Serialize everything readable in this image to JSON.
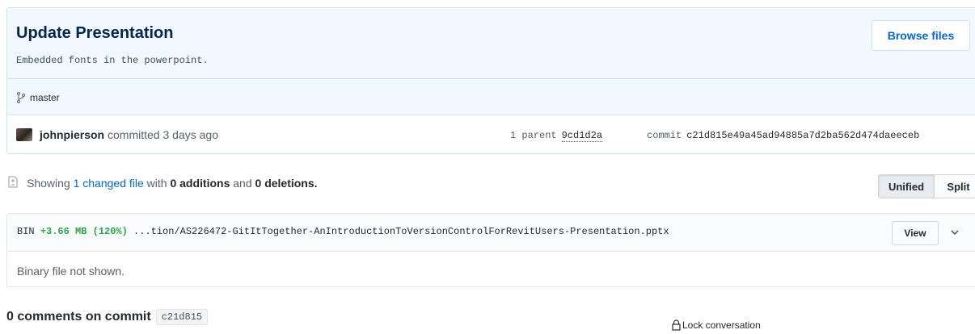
{
  "commit": {
    "title": "Update Presentation",
    "description": "Embedded fonts in the powerpoint.",
    "browse_label": "Browse files",
    "branch": "master",
    "author": "johnpierson",
    "committed_text": "committed 3 days ago",
    "parent_label": "1 parent",
    "parent_sha": "9cd1d2a",
    "commit_label": "commit",
    "commit_sha": "c21d815e49a45ad94885a7d2ba562d474daeeceb"
  },
  "toc": {
    "showing": "Showing",
    "changed_files": "1 changed file",
    "with": "with",
    "additions": "0 additions",
    "and": "and",
    "deletions": "0 deletions.",
    "unified_label": "Unified",
    "split_label": "Split"
  },
  "file": {
    "bin_label": "BIN",
    "stat": "+3.66 MB (120%)",
    "path": "...tion/AS226472-GitItTogether-AnIntroductionToVersionControlForRevitUsers-Presentation.pptx",
    "view_label": "View",
    "body": "Binary file not shown."
  },
  "comments": {
    "title": "0 comments on commit",
    "sha": "c21d815",
    "lock_label": "Lock conversation"
  },
  "colors": {
    "link": "#0366d6",
    "addition": "#28a745",
    "header_bg": "#f1f8ff",
    "border_blue": "#c8e1ff"
  }
}
